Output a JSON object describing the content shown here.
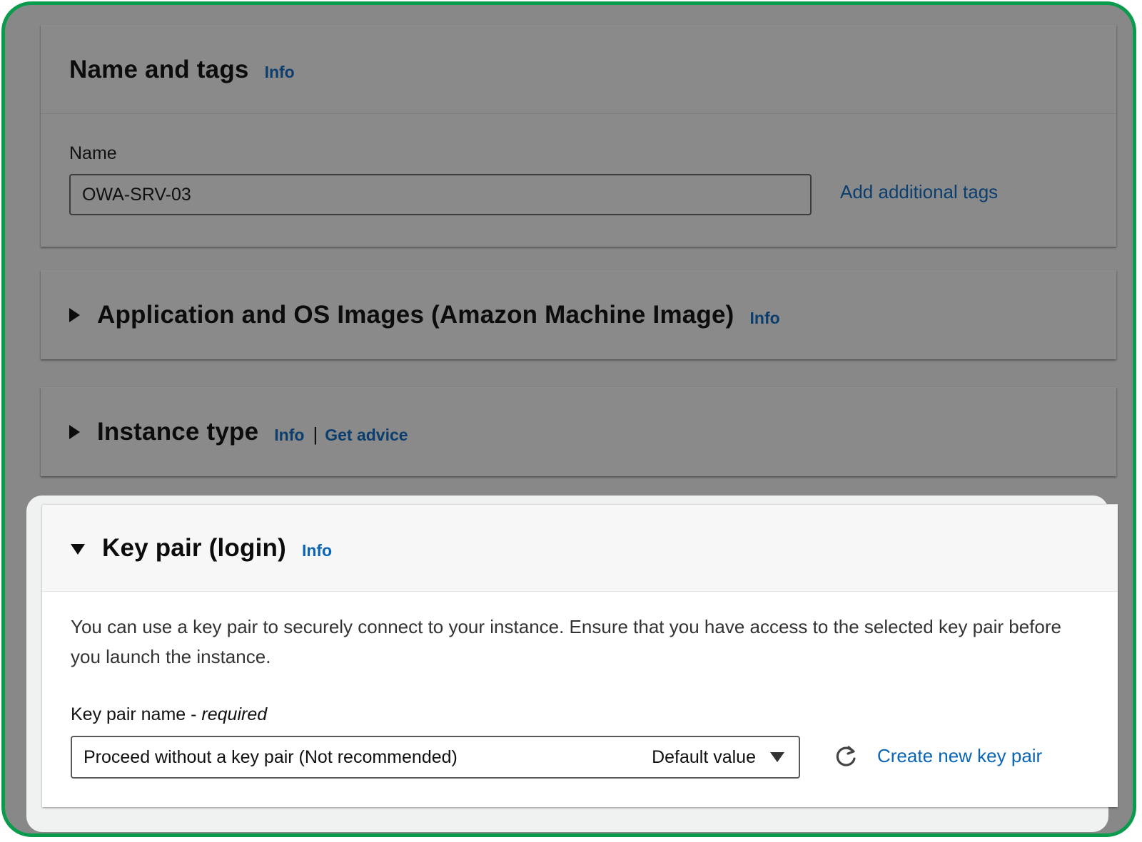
{
  "name_and_tags": {
    "title": "Name and tags",
    "info": "Info",
    "name_label": "Name",
    "name_value": "OWA-SRV-03",
    "add_tags": "Add additional tags"
  },
  "ami": {
    "title": "Application and OS Images (Amazon Machine Image)",
    "info": "Info",
    "expanded": false
  },
  "instance_type": {
    "title": "Instance type",
    "info": "Info",
    "separator": "|",
    "get_advice": "Get advice",
    "expanded": false
  },
  "key_pair": {
    "title": "Key pair (login)",
    "info": "Info",
    "expanded": true,
    "description": "You can use a key pair to securely connect to your instance. Ensure that you have access to the selected key pair before you launch the instance.",
    "field_label": "Key pair name - ",
    "field_required": "required",
    "selected_value": "Proceed without a key pair (Not recommended)",
    "selected_tag": "Default value",
    "create_link": "Create new key pair"
  },
  "colors": {
    "frame_border": "#0a9c4c",
    "link": "#0a66b5",
    "overlay": "#888888"
  },
  "icons": [
    "caret-right-icon",
    "caret-down-icon",
    "dropdown-caret-icon",
    "refresh-icon"
  ]
}
